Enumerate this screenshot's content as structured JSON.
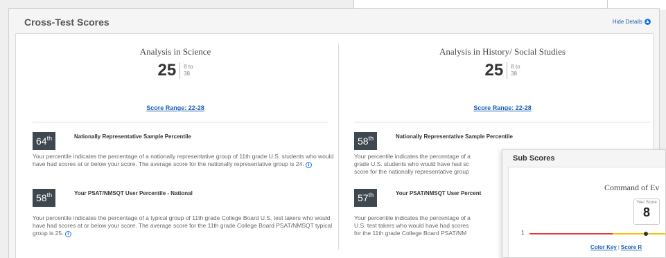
{
  "panel": {
    "title": "Cross-Test Scores",
    "hide_details": "Hide Details"
  },
  "left": {
    "title": "Analysis in Science",
    "score": "25",
    "range_line1": "8 to",
    "range_line2": "38",
    "score_range": "Score Range: 22-28",
    "nat_pct": "64",
    "nat_label": "Nationally Representative Sample Percentile",
    "nat_text": "Your percentile indicates the percentage of a nationally representative group of 11th grade U.S. students who would have had scores at or below your score. The average score for the nationally representative group is 24.",
    "user_pct": "58",
    "user_label": "Your PSAT/NMSQT User Percentile - National",
    "user_text": "Your percentile indicates the percentage of a typical group of 11th grade College Board U.S. test takers who would have had scores at or below your score. The average score for the 11th grade College Board PSAT/NMSQT typical group is 25."
  },
  "right": {
    "title": "Analysis in History/ Social Studies",
    "score": "25",
    "range_line1": "8 to",
    "range_line2": "38",
    "score_range": "Score Range: 22-28",
    "nat_pct": "58",
    "nat_label": "Nationally Representative Sample Percentile",
    "nat_text_l1": "Your percentile indicates the percentage of a",
    "nat_text_l2": "grade U.S. students who would have had sc",
    "nat_text_l3": "score for the nationally representative group",
    "user_pct": "57",
    "user_label": "Your PSAT/NMSQT User Percent",
    "user_text_l1": "Your percentile indicates the percentage of a",
    "user_text_l2": "U.S. test takers who would have had scores",
    "user_text_l3": "for the 11th grade College Board PSAT/NM"
  },
  "ordinal_suffix": "th",
  "sub_scores": {
    "title": "Sub Scores",
    "name": "Command of Ev",
    "your_score_label": "Your Score",
    "your_score": "8",
    "scale_start": "1",
    "color_key": "Color Key",
    "score_range_link": "Score R",
    "separator": "|"
  },
  "colors": {
    "accent": "#1a5fb4",
    "badge": "#3f474f",
    "track_red": "#e53935",
    "track_yellow": "#f2c200"
  }
}
